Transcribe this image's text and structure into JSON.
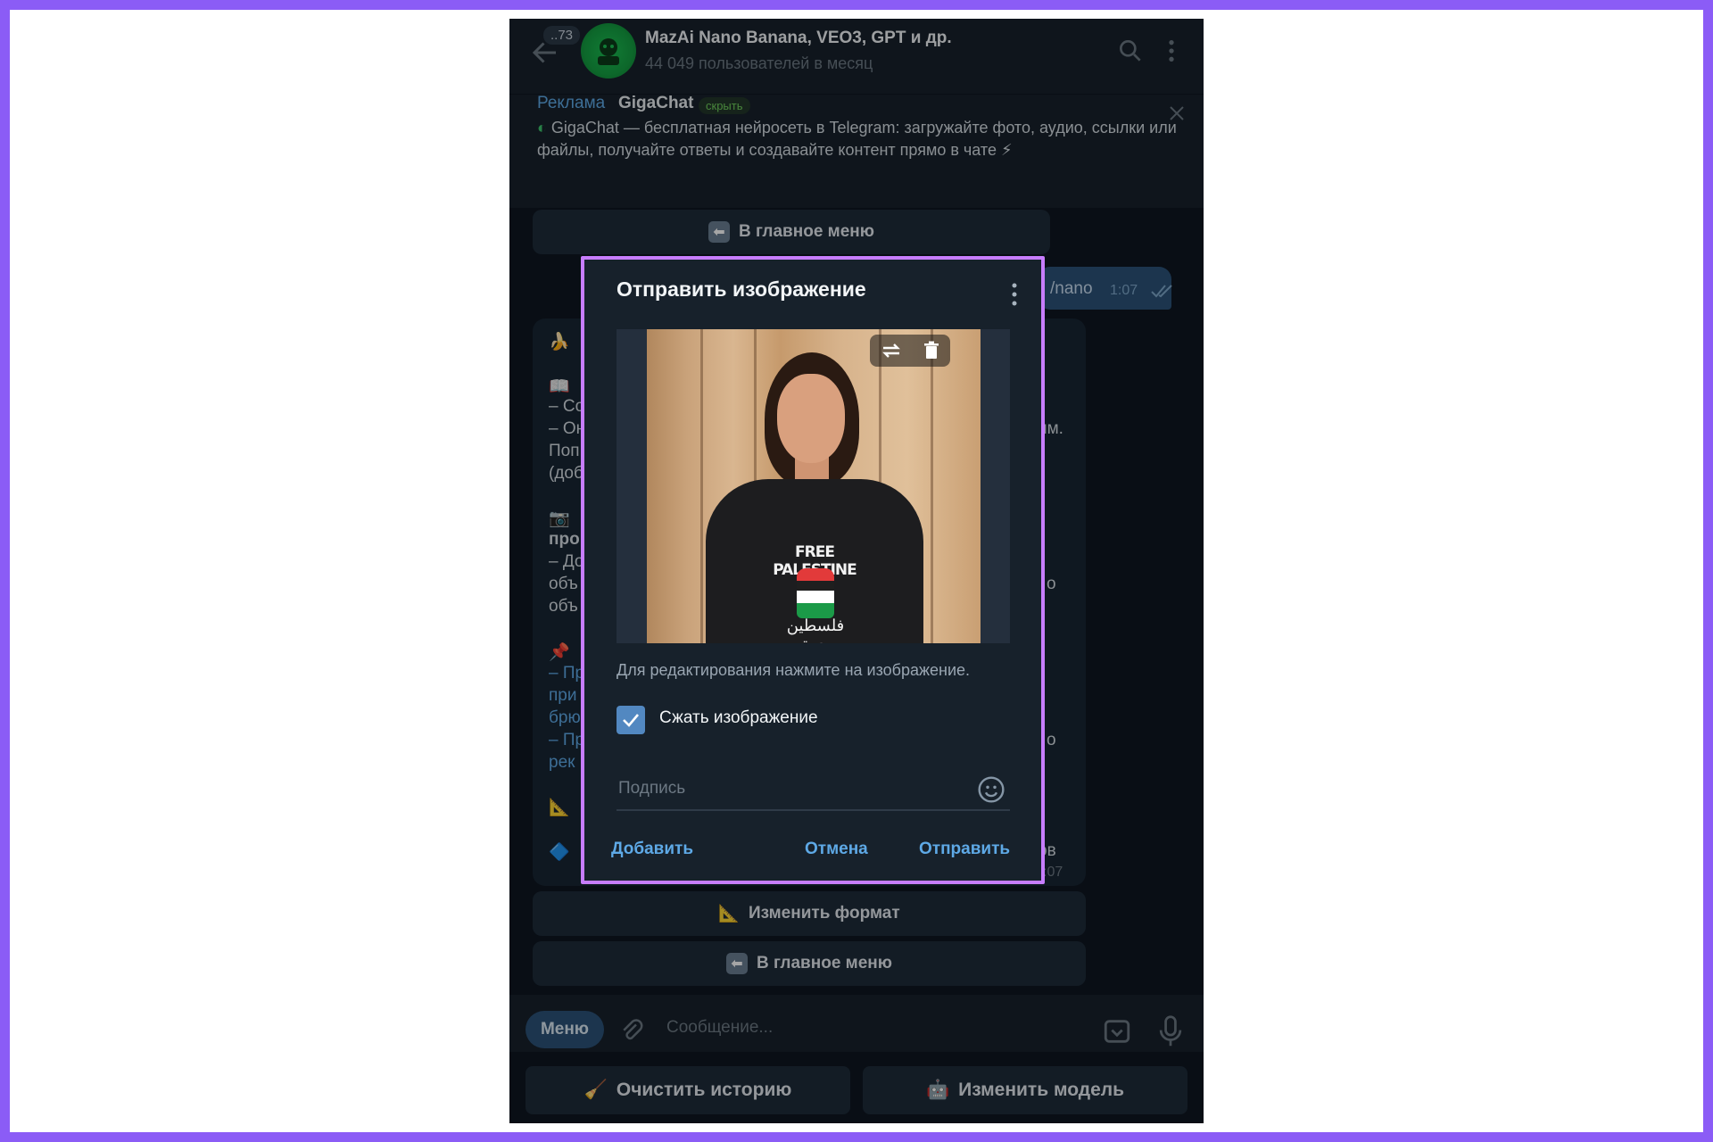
{
  "header": {
    "unread_count": "..73",
    "title": "MazAi Nano Banana, VEO3, GPT и др.",
    "subtitle": "44 049 пользователей в месяц"
  },
  "ad": {
    "label": "Реклама",
    "brand": "GigaChat",
    "hide": "скрыть",
    "text": "GigaChat — бесплатная нейросеть в Telegram: загружайте фото, аудио, ссылки или файлы, получайте ответы и создавайте контент прямо в чате"
  },
  "chat": {
    "main_menu_top": "В главное меню",
    "out_message": "/nano",
    "out_time": "1:07",
    "in_fragments": [
      "– Со",
      "– Он",
      "Поп",
      "(доб",
      "про",
      "– До",
      "объ",
      "объ",
      "– Пр",
      "при",
      "брю",
      "– Пр",
      "рек"
    ],
    "in_right_fragments": [
      "им.",
      "о",
      "о",
      "ов"
    ],
    "in_time": ":07",
    "change_format": "Изменить формат",
    "main_menu_bottom": "В главное меню"
  },
  "input": {
    "menu_label": "Меню",
    "placeholder": "Сообщение..."
  },
  "bottom_keys": {
    "clear_history": "Очистить историю",
    "change_model": "Изменить модель"
  },
  "modal": {
    "title": "Отправить изображение",
    "photo_shirt_text": "FREE PALESTINE",
    "photo_shirt_arabic": "فلسطين حرة",
    "hint": "Для редактирования нажмите на изображение.",
    "compress_label": "Сжать изображение",
    "compress_checked": true,
    "caption_placeholder": "Подпись",
    "add_button": "Добавить",
    "cancel_button": "Отмена",
    "send_button": "Отправить"
  },
  "colors": {
    "background": "#8b5cf6",
    "app_bg": "#0e1621",
    "panel": "#17212b",
    "accent": "#5ea9e6",
    "modal_border": "#c77dff"
  }
}
